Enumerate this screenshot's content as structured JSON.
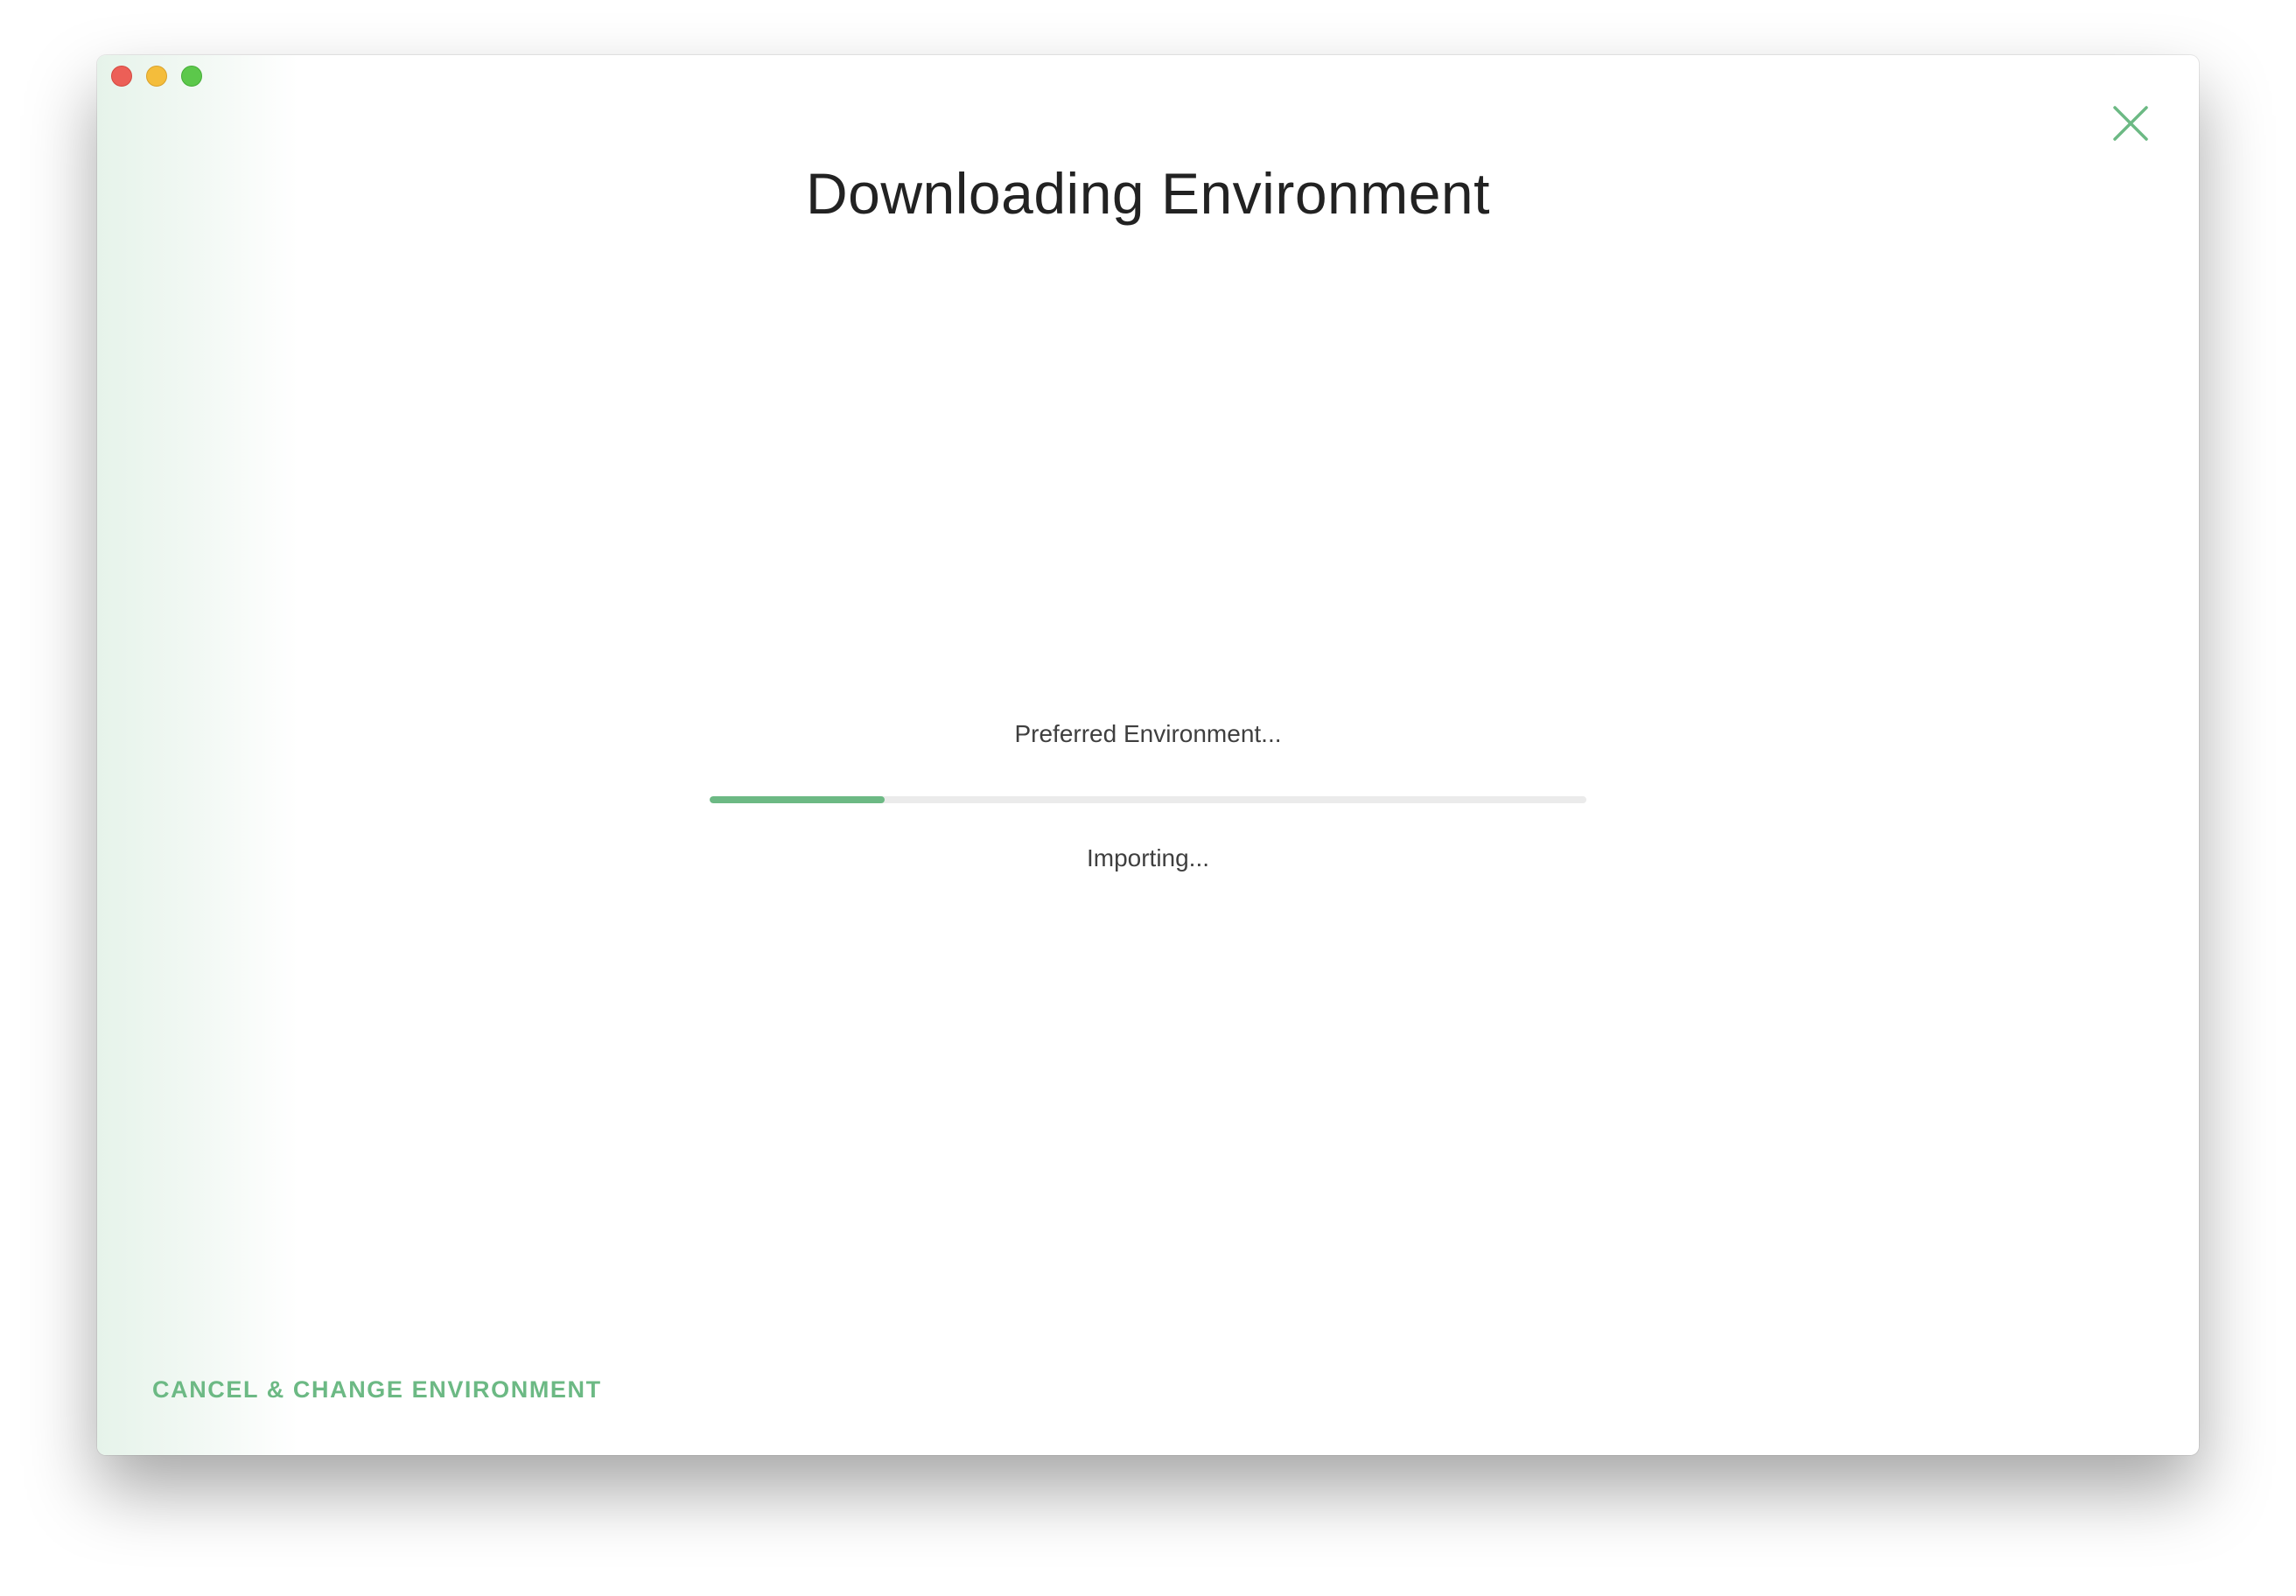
{
  "dialog": {
    "title": "Downloading Environment",
    "environment_label": "Preferred Environment...",
    "progress": 0.2,
    "status_text": "Importing...",
    "cancel_label": "CANCEL & CHANGE ENVIRONMENT",
    "close_icon": "close-icon"
  },
  "colors": {
    "accent": "#6cb984",
    "track": "#ebebeb",
    "title": "#222222",
    "text": "#3f3f3f",
    "traffic_red": "#ec5f57",
    "traffic_yellow": "#f4bd3b",
    "traffic_green": "#5cc84b"
  }
}
